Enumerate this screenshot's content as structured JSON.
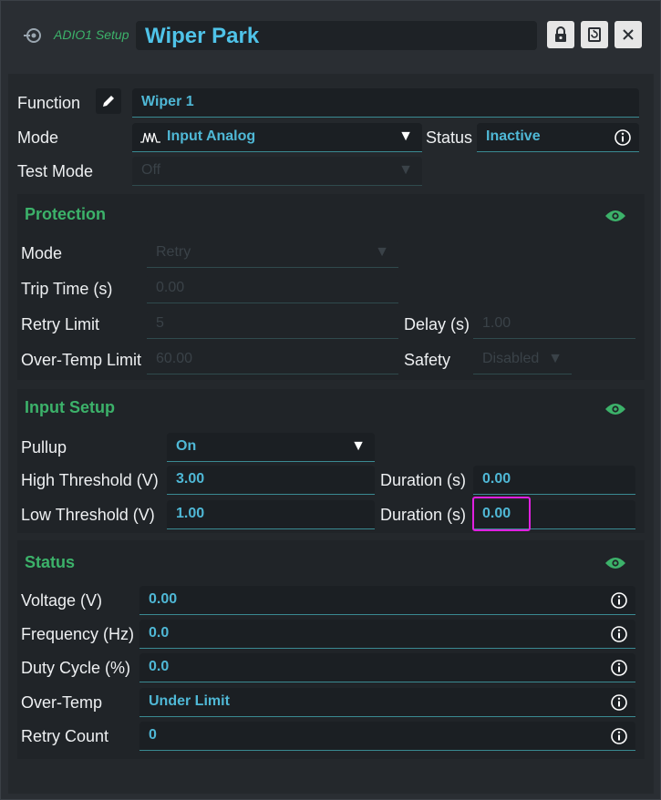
{
  "header": {
    "module": "ADIO1 Setup",
    "title": "Wiper Park"
  },
  "main": {
    "function_label": "Function",
    "function_value": "Wiper 1",
    "mode_label": "Mode",
    "mode_value": "Input Analog",
    "status_label": "Status",
    "status_value": "Inactive",
    "test_mode_label": "Test Mode",
    "test_mode_value": "Off"
  },
  "protection": {
    "title": "Protection",
    "mode_label": "Mode",
    "mode_value": "Retry",
    "trip_time_label": "Trip Time (s)",
    "trip_time_value": "0.00",
    "retry_limit_label": "Retry Limit",
    "retry_limit_value": "5",
    "delay_label": "Delay (s)",
    "delay_value": "1.00",
    "over_temp_label": "Over-Temp Limit",
    "over_temp_value": "60.00",
    "safety_label": "Safety",
    "safety_value": "Disabled"
  },
  "input_setup": {
    "title": "Input Setup",
    "pullup_label": "Pullup",
    "pullup_value": "On",
    "high_threshold_label": "High Threshold (V)",
    "high_threshold_value": "3.00",
    "high_duration_label": "Duration (s)",
    "high_duration_value": "0.00",
    "low_threshold_label": "Low Threshold (V)",
    "low_threshold_value": "1.00",
    "low_duration_label": "Duration (s)",
    "low_duration_value": "0.00"
  },
  "status": {
    "title": "Status",
    "rows": [
      {
        "label": "Voltage (V)",
        "value": "0.00"
      },
      {
        "label": "Frequency (Hz)",
        "value": "0.0"
      },
      {
        "label": "Duty Cycle (%)",
        "value": "0.0"
      },
      {
        "label": "Over-Temp",
        "value": "Under Limit"
      },
      {
        "label": "Retry Count",
        "value": "0"
      }
    ]
  },
  "colors": {
    "accent_green": "#3cb26a",
    "value_blue": "#4fb8d6",
    "title_blue": "#4fc3e8",
    "highlight": "#e020e0"
  },
  "icons": {
    "module": "module-icon",
    "lock": "lock-icon",
    "refresh": "refresh-icon",
    "close": "close-icon",
    "edit": "pencil-icon",
    "waveform": "waveform-icon",
    "info": "info-icon",
    "eye": "eye-icon"
  }
}
